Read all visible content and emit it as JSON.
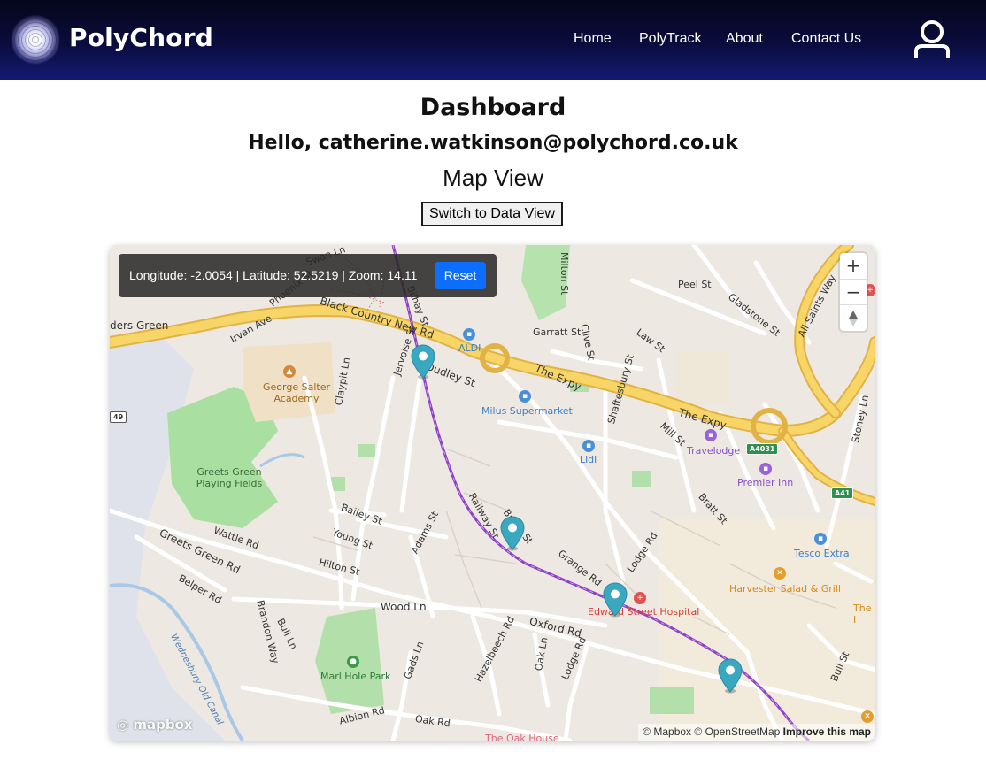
{
  "nav": {
    "brand": "PolyChord",
    "links": [
      "Home",
      "PolyTrack",
      "About",
      "Contact Us"
    ]
  },
  "page": {
    "title": "Dashboard",
    "greeting": "Hello, catherine.watkinson@polychord.co.uk",
    "view_title": "Map View",
    "switch_button": "Switch to Data View"
  },
  "map": {
    "info": {
      "longitude": "-2.0054",
      "latitude": "52.5219",
      "zoom": "14.11",
      "text": "Longitude: -2.0054 | Latitude: 52.5219 | Zoom: 14.11"
    },
    "reset_label": "Reset",
    "zoom_in": "+",
    "zoom_out": "−",
    "compass": "▲",
    "markers": [
      {
        "name": "marker-1"
      },
      {
        "name": "marker-2"
      },
      {
        "name": "marker-3"
      },
      {
        "name": "marker-4"
      }
    ],
    "labels": {
      "greets_green": "Greets Green",
      "greets_green_partial": "ders Green",
      "black_country_new_rd": "Black Country New Rd",
      "phoenix_st": "Phoenix St",
      "irvan_ave": "Irvan Ave",
      "swan_ln": "Swan Ln",
      "bilhay_st": "Bilhay St",
      "milton_st": "Milton St",
      "peel_st": "Peel St",
      "gladstone_st": "Gladstone St",
      "all_saints_way": "All Saints Way",
      "garratt_st": "Garratt St",
      "clive_st": "Clive St",
      "law_st": "Law St",
      "aldi": "ALDI",
      "the_expy_1": "The Expy",
      "the_expy_2": "The Expy",
      "dudley_st": "Dudley St",
      "george_salter_academy": "George Salter Academy",
      "jervoise_st": "Jervoise St",
      "claypit_ln": "Claypit Ln",
      "milus_supermarket": "Milus Supermarket",
      "shaftesbury_st": "Shaftesbury St",
      "mill_st": "Mill St",
      "travelodge": "Travelodge",
      "lidl": "Lidl",
      "premier_inn": "Premier Inn",
      "stoney_ln": "Stoney Ln",
      "a4031": "A4031",
      "a41": "A41",
      "b_49": "49",
      "bratt_st": "Bratt St",
      "greets_green_playing_fields": "Greets Green Playing Fields",
      "bailey_st": "Bailey St",
      "young_st": "Young St",
      "wattle_rd": "Wattle Rd",
      "greets_green_rd": "Greets Green Rd",
      "hilton_st": "Hilton St",
      "adams_st": "Adams St",
      "railway_st": "Railway St",
      "brook_st": "Brook St",
      "grange_rd": "Grange Rd",
      "lodge_rd": "Lodge Rd",
      "tesco_extra": "Tesco Extra",
      "harvester": "Harvester Salad & Grill",
      "the_house": "The House I",
      "edward_street_hospital": "Edward Street Hospital",
      "belper_rd": "Belper Rd",
      "wood_ln": "Wood Ln",
      "oxford_rd": "Oxford Rd",
      "brandon_way": "Brandon Way",
      "bull_ln": "Bull Ln",
      "marl_hole_park": "Marl Hole Park",
      "gads_ln": "Gads Ln",
      "hazelbeech_rd": "Hazelbeech Rd",
      "oak_ln": "Oak Ln",
      "lodge_rd_2": "Lodge Rd",
      "bull_st": "Bull St",
      "albion_rd": "Albion Rd",
      "oak_rd": "Oak Rd",
      "the_oak_house": "The Oak House",
      "wednesbury_old_canal": "Wednesbury Old Canal"
    },
    "attribution": {
      "mapbox": "© Mapbox",
      "osm": "© OpenStreetMap",
      "improve": "Improve this map"
    },
    "logo_text": "mapbox"
  },
  "colors": {
    "nav_bg": "#0a0c3d",
    "reset_button": "#0d6efd",
    "marker": "#3aa8c1",
    "railway": "#8e3fc8",
    "major_road": "#f4cc5c"
  },
  "icons": {
    "user": "user-icon",
    "logo": "polychord-logo-icon",
    "marker": "map-marker-icon"
  }
}
